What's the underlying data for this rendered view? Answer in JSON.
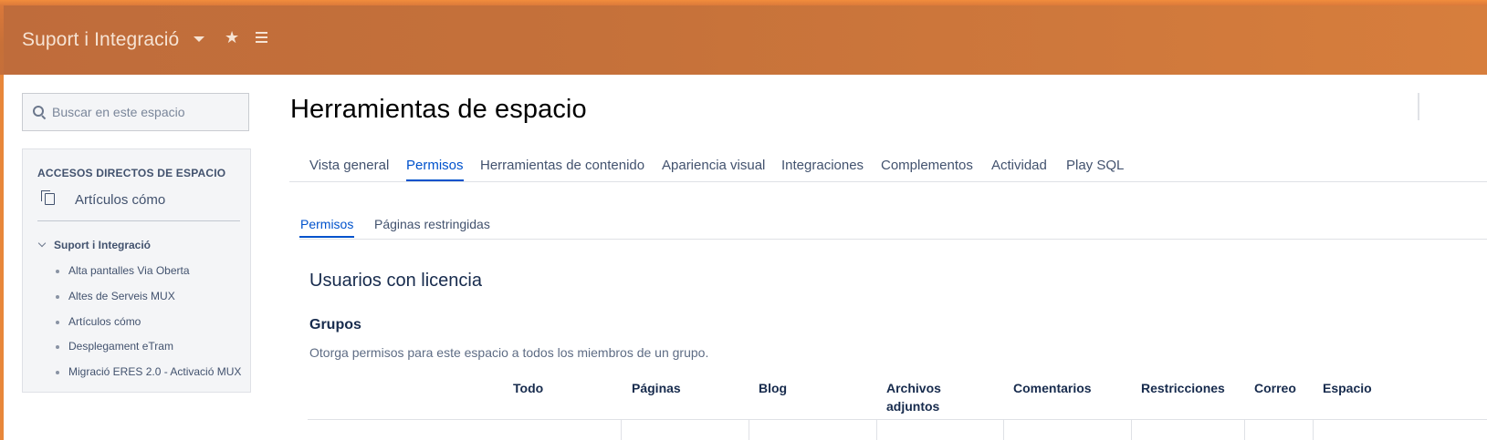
{
  "header": {
    "space_name": "Suport i Integració",
    "dropdown_icon": "caret-down-icon",
    "star_icon": "star-icon",
    "menu_icon": "menu-lines-icon"
  },
  "sidebar": {
    "search_placeholder": "Buscar en este espacio",
    "shortcuts_heading": "ACCESOS DIRECTOS DE ESPACIO",
    "shortcut_label": "Artículos cómo",
    "tree_root": "Suport i Integració",
    "tree_items": [
      "Alta pantalles Via Oberta",
      "Altes de Serveis MUX",
      "Artículos cómo",
      "Desplegament eTram",
      "Migració ERES 2.0 - Activació MUX"
    ]
  },
  "main": {
    "title": "Herramientas de espacio",
    "tabs": [
      "Vista general",
      "Permisos",
      "Herramientas de contenido",
      "Apariencia visual",
      "Integraciones",
      "Complementos",
      "Actividad",
      "Play SQL"
    ],
    "active_tab": "Permisos",
    "subtabs": [
      "Permisos",
      "Páginas restringidas"
    ],
    "active_subtab": "Permisos",
    "section_title": "Usuarios con licencia",
    "groups_title": "Grupos",
    "groups_description": "Otorga permisos para este espacio a todos los miembros de un grupo.",
    "table_headers": [
      "Todo",
      "Páginas",
      "Blog",
      "Archivos adjuntos",
      "Comentarios",
      "Restricciones",
      "Correo",
      "Espacio"
    ]
  },
  "colors": {
    "header_orange": "#c5713a",
    "link_blue": "#0052cc",
    "text_dark": "#172b4d"
  }
}
